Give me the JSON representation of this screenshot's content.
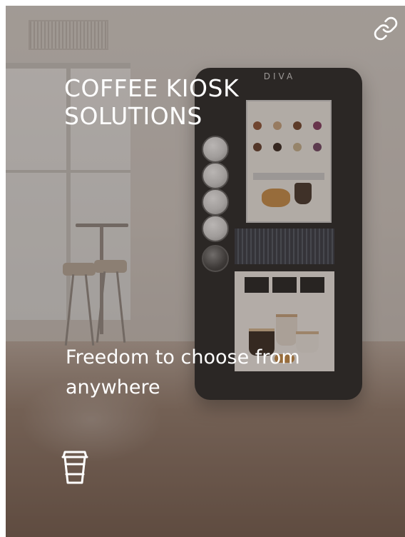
{
  "card": {
    "heading": "COFFEE KIOSK SOLUTIONS",
    "subtitle": "Freedom to choose from anywhere",
    "kiosk_brand": "DIVA",
    "icons": {
      "top_right": "link-icon",
      "bottom": "coffee-cup-icon"
    },
    "colors": {
      "text": "#ffffff",
      "overlay": "#463c37"
    }
  }
}
